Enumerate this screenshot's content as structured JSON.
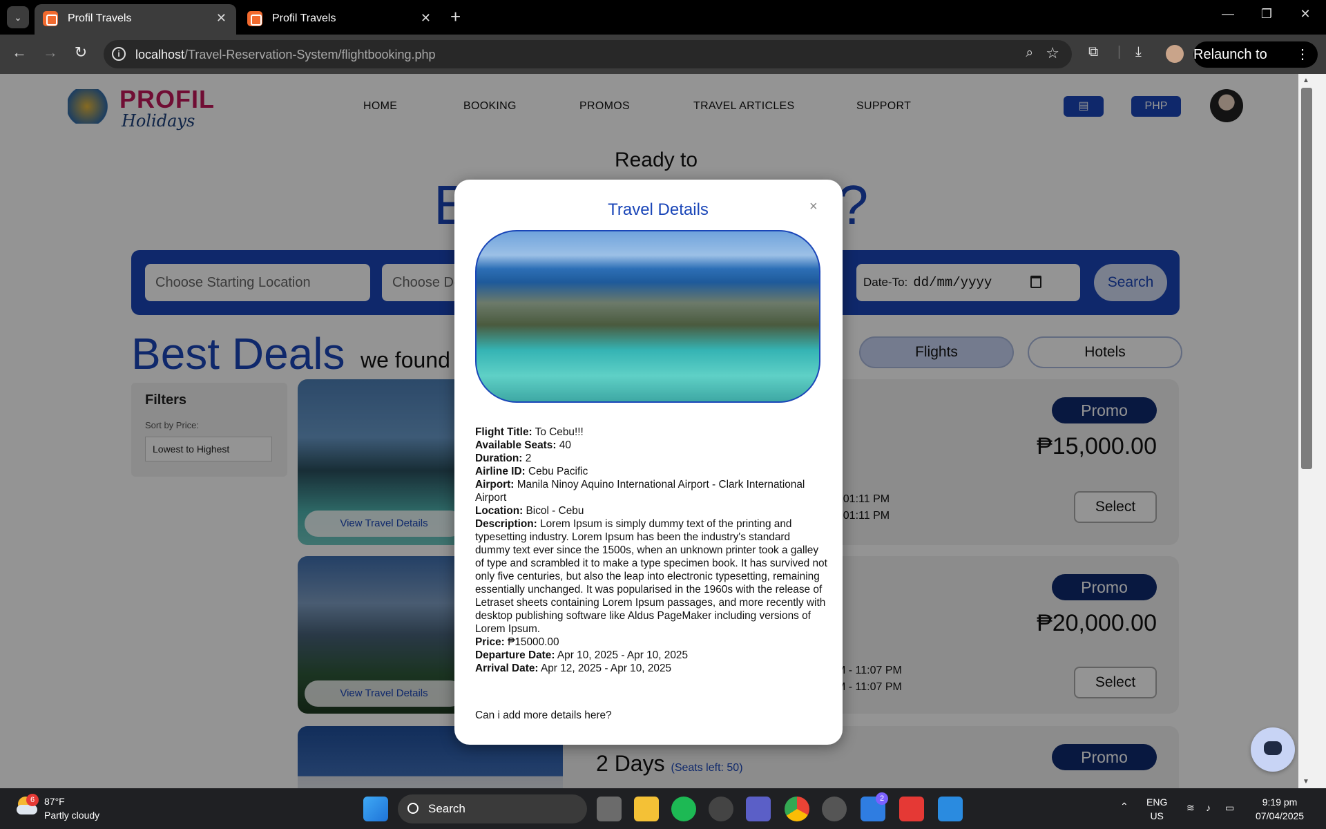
{
  "browser": {
    "tabs": [
      {
        "title": "Profil Travels",
        "active": true
      },
      {
        "title": "Profil Travels",
        "active": false
      }
    ],
    "url_host": "localhost",
    "url_path": "/Travel-Reservation-System/flightbooking.php",
    "relaunch_label": "Relaunch to update"
  },
  "site": {
    "logo_brand": "PROFIL",
    "logo_sub": "Holidays",
    "nav": [
      "HOME",
      "BOOKING",
      "PROMOS",
      "TRAVEL ARTICLES",
      "SUPPORT"
    ],
    "currency_label": "PHP",
    "hero_line1": "Ready to",
    "hero_line2_left": "E",
    "hero_line2_right": "l?",
    "search": {
      "start_placeholder": "Choose Starting Location",
      "dest_placeholder": "Choose De",
      "date_to_label": "Date-To:",
      "date_to_value": "dd/mm/yyyy",
      "button": "Search"
    },
    "best_deals": "Best Deals",
    "we_found": "we found",
    "toggle_flights": "Flights",
    "toggle_hotels": "Hotels",
    "filters": {
      "title": "Filters",
      "sort_label": "Sort by Price:",
      "sort_value": "Lowest to Highest"
    },
    "cards": [
      {
        "badge": "Promo",
        "price": "₱15,000.00",
        "times": [
          "- 01:11 PM",
          "- 01:11 PM"
        ],
        "select": "Select",
        "view": "View Travel Details"
      },
      {
        "badge": "Promo",
        "price": "₱20,000.00",
        "times": [
          "M - 11:07 PM",
          "M - 11:07 PM"
        ],
        "select": "Select",
        "view": "View Travel Details"
      },
      {
        "badge": "Promo",
        "days": "2 Days",
        "seats": "(Seats left: 50)"
      }
    ]
  },
  "modal": {
    "title": "Travel Details",
    "close": "×",
    "fields": [
      {
        "label": "Flight Title:",
        "value": "To Cebu!!!"
      },
      {
        "label": "Available Seats:",
        "value": "40"
      },
      {
        "label": "Duration:",
        "value": "2"
      },
      {
        "label": "Airline ID:",
        "value": "Cebu Pacific"
      },
      {
        "label": "Airport:",
        "value": "Manila Ninoy Aquino International Airport - Clark International Airport"
      },
      {
        "label": "Location:",
        "value": "Bicol - Cebu"
      },
      {
        "label": "Description:",
        "value": "Lorem Ipsum is simply dummy text of the printing and typesetting industry. Lorem Ipsum has been the industry's standard dummy text ever since the 1500s, when an unknown printer took a galley of type and scrambled it to make a type specimen book. It has survived not only five centuries, but also the leap into electronic typesetting, remaining essentially unchanged. It was popularised in the 1960s with the release of Letraset sheets containing Lorem Ipsum passages, and more recently with desktop publishing software like Aldus PageMaker including versions of Lorem Ipsum."
      },
      {
        "label": "Price:",
        "value": "₱15000.00"
      },
      {
        "label": "Departure Date:",
        "value": "Apr 10, 2025 - Apr 10, 2025"
      },
      {
        "label": "Arrival Date:",
        "value": "Apr 12, 2025 - Apr 10, 2025"
      }
    ],
    "extra_note": "Can i add more details here?"
  },
  "taskbar": {
    "weather_temp": "87°F",
    "weather_desc": "Partly cloudy",
    "weather_badge": "6",
    "search_label": "Search",
    "todo_badge": "2",
    "lang": "ENG",
    "region": "US",
    "time": "9:19 pm",
    "date": "07/04/2025"
  },
  "colors": {
    "brand_blue": "#1a46b8",
    "promo_navy": "#0f2a6e",
    "logo_magenta": "#c2185b"
  }
}
